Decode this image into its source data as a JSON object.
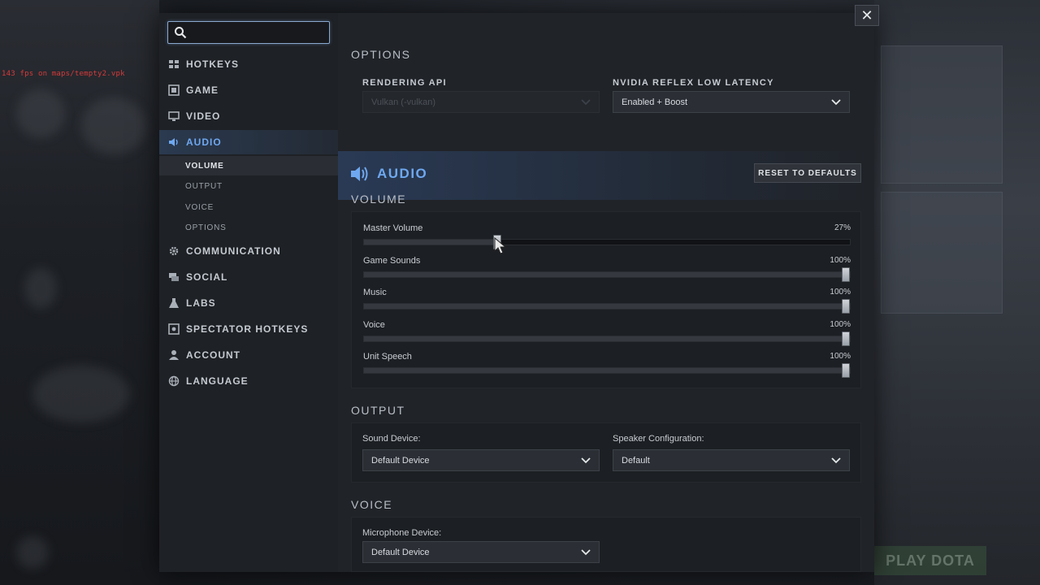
{
  "overlay": {
    "fps_text": "143 fps on maps/tempty2.vpk",
    "play_button": "PLAY DOTA"
  },
  "search": {
    "placeholder": "",
    "value": ""
  },
  "sidebar": {
    "items": [
      {
        "label": "HOTKEYS",
        "icon": "keyboard-icon"
      },
      {
        "label": "GAME",
        "icon": "game-icon"
      },
      {
        "label": "VIDEO",
        "icon": "monitor-icon"
      },
      {
        "label": "AUDIO",
        "icon": "speaker-icon",
        "active": true
      },
      {
        "label": "COMMUNICATION",
        "icon": "gear-icon"
      },
      {
        "label": "SOCIAL",
        "icon": "chat-icon"
      },
      {
        "label": "LABS",
        "icon": "flask-icon"
      },
      {
        "label": "SPECTATOR HOTKEYS",
        "icon": "spectator-icon"
      },
      {
        "label": "ACCOUNT",
        "icon": "user-icon"
      },
      {
        "label": "LANGUAGE",
        "icon": "globe-icon"
      }
    ],
    "audio_sub": [
      {
        "label": "VOLUME",
        "active": true
      },
      {
        "label": "OUTPUT"
      },
      {
        "label": "VOICE"
      },
      {
        "label": "OPTIONS"
      }
    ]
  },
  "options": {
    "title": "OPTIONS",
    "rendering_api_label": "RENDERING API",
    "rendering_api_value": "Vulkan (-vulkan)",
    "reflex_label": "NVIDIA REFLEX LOW LATENCY",
    "reflex_value": "Enabled + Boost"
  },
  "audio": {
    "title": "AUDIO",
    "reset_label": "RESET TO DEFAULTS",
    "volume_title": "VOLUME",
    "sliders": [
      {
        "label": "Master Volume",
        "value_text": "27%",
        "value": 0.27
      },
      {
        "label": "Game Sounds",
        "value_text": "100%",
        "value": 1.0
      },
      {
        "label": "Music",
        "value_text": "100%",
        "value": 1.0
      },
      {
        "label": "Voice",
        "value_text": "100%",
        "value": 1.0
      },
      {
        "label": "Unit Speech",
        "value_text": "100%",
        "value": 1.0
      }
    ],
    "output_title": "OUTPUT",
    "sound_device_label": "Sound Device:",
    "sound_device_value": "Default Device",
    "speaker_config_label": "Speaker Configuration:",
    "speaker_config_value": "Default",
    "voice_title": "VOICE",
    "mic_label": "Microphone Device:",
    "mic_value": "Default Device"
  },
  "colors": {
    "accent": "#6ea8f0",
    "panel": "#202328",
    "sidebar": "#1e2125"
  }
}
